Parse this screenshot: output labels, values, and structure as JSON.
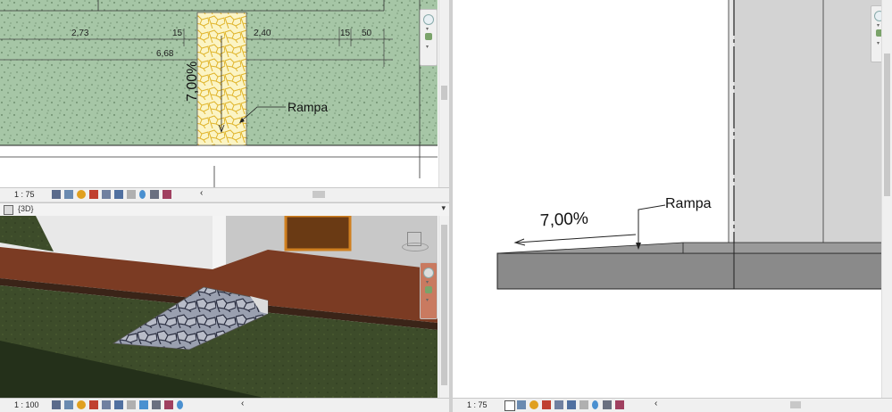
{
  "views": {
    "plan": {
      "scale_label": "1 : 75",
      "dims": {
        "d1": "2,73",
        "d2": "15",
        "d3": "2,40",
        "d4": "15",
        "d5": "50",
        "total": "6,68"
      },
      "slope_label": "7,00%",
      "ramp_label": "Rampa"
    },
    "three_d": {
      "title": "{3D}",
      "scale_label": "1 : 100"
    },
    "section": {
      "scale_label": "1 : 75",
      "slope_label": "7,00%",
      "ramp_label": "Rampa"
    }
  },
  "icons": [
    "view-cube-icon",
    "navigation-wheel-icon",
    "zoom-icon",
    "pan-icon",
    "detail-level-icon",
    "visual-style-icon",
    "sun-path-icon",
    "shadows-icon",
    "crop-icon",
    "show-crop-icon",
    "temporary-hide-icon",
    "reveal-hidden-icon",
    "analytical-icon",
    "highlight-displacement-icon",
    "scroll-left-icon"
  ],
  "colors": {
    "plan_ground": "#a8c8a8",
    "ramp_fill": "#f4e8a0",
    "grass_3d": "#3a4a28",
    "deck_3d": "#7a3a22",
    "wall_3d": "#bfbfbf",
    "section_fill": "#8a8a8a"
  }
}
